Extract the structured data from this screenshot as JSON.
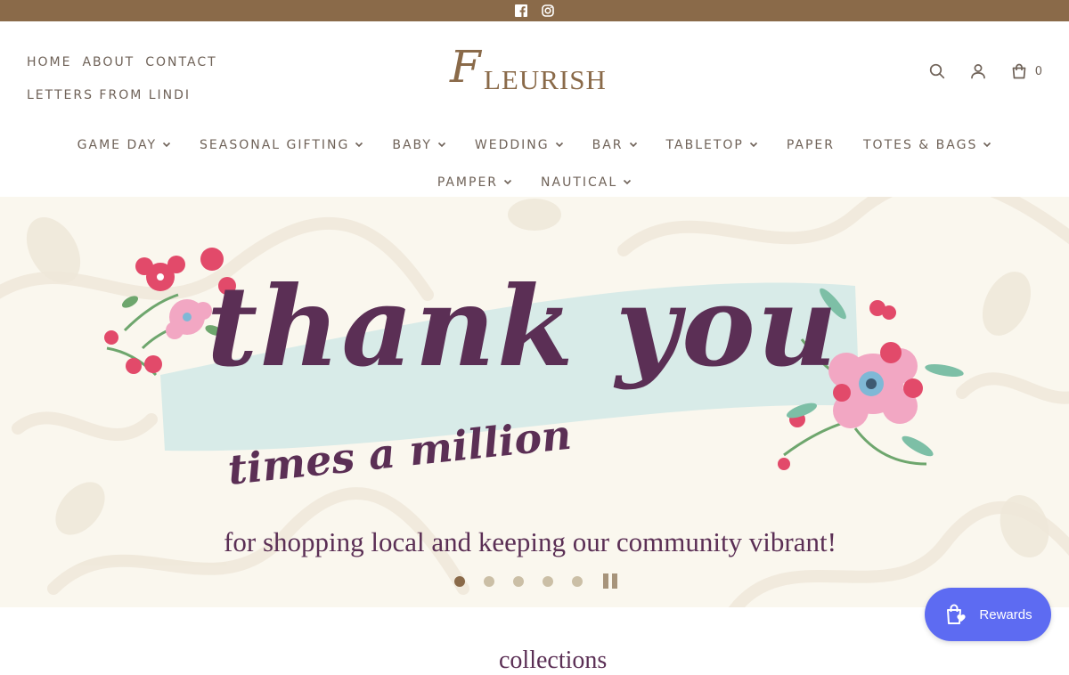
{
  "topbar": {
    "background": "#8a6a49",
    "social": [
      "facebook-icon",
      "instagram-icon"
    ]
  },
  "util_nav": {
    "home": "HOME",
    "about": "ABOUT",
    "contact": "CONTACT",
    "letters": "LETTERS FROM LINDI"
  },
  "logo": {
    "initial": "F",
    "rest": "LEURISH"
  },
  "header_icons": {
    "search": "search-icon",
    "account": "user-icon",
    "cart": "bag-icon",
    "cart_count": "0"
  },
  "main_nav": {
    "row1": [
      {
        "label": "GAME DAY",
        "has_menu": true
      },
      {
        "label": "SEASONAL GIFTING",
        "has_menu": true
      },
      {
        "label": "BABY",
        "has_menu": true
      },
      {
        "label": "WEDDING",
        "has_menu": true
      },
      {
        "label": "BAR",
        "has_menu": true
      },
      {
        "label": "TABLETOP",
        "has_menu": true
      },
      {
        "label": "PAPER",
        "has_menu": false
      },
      {
        "label": "TOTES & BAGS",
        "has_menu": true
      }
    ],
    "row2": [
      {
        "label": "PAMPER",
        "has_menu": true
      },
      {
        "label": "NAUTICAL",
        "has_menu": true
      }
    ]
  },
  "hero": {
    "headline": "thank you",
    "subhead": "times a million",
    "tagline": "for shopping local and keeping our community vibrant!",
    "slides": 5,
    "active_slide": 1,
    "accent": "#5b2f55",
    "ribbon": "#d8ebe8"
  },
  "rewards": {
    "label": "Rewards",
    "color": "#5d6bf2"
  },
  "below": {
    "partial_heading": "collections"
  }
}
